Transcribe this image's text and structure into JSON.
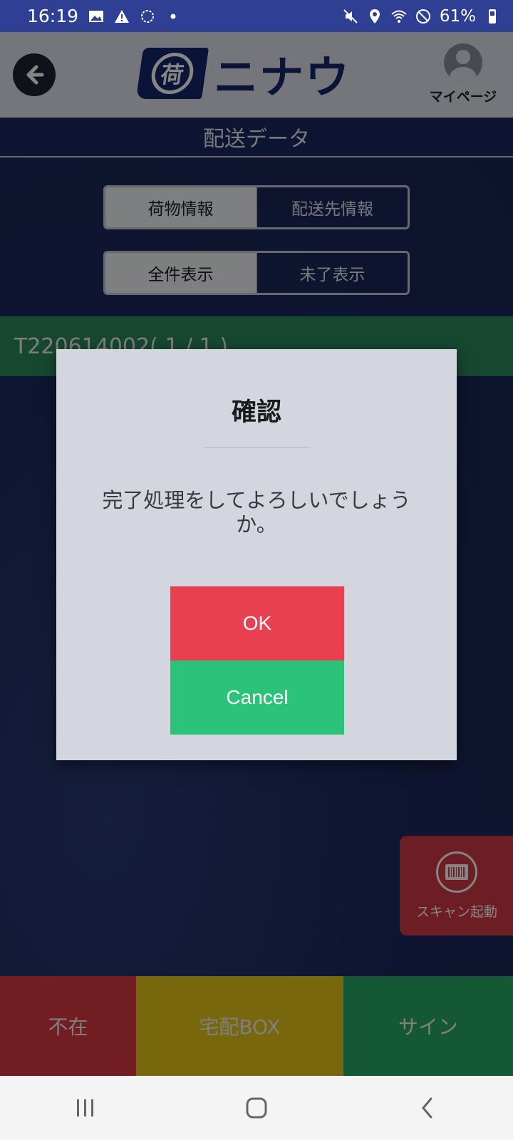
{
  "status_bar": {
    "time": "16:19",
    "battery": "61%",
    "left_icons": [
      "image-icon",
      "warning-icon",
      "sync-icon",
      "dot-icon"
    ],
    "right_icons": [
      "mute-icon",
      "location-icon",
      "wifi-icon",
      "no-disturb-icon",
      "battery-icon"
    ]
  },
  "header": {
    "logo_mark": "荷",
    "logo_text": "ニナウ",
    "mypage_label": "マイページ"
  },
  "page": {
    "title": "配送データ"
  },
  "tabs": {
    "info": [
      {
        "label": "荷物情報",
        "active": true
      },
      {
        "label": "配送先情報",
        "active": false
      }
    ],
    "filter": [
      {
        "label": "全件表示",
        "active": true
      },
      {
        "label": "未了表示",
        "active": false
      }
    ]
  },
  "tracking": {
    "label": "T220614002( 1 / 1 )"
  },
  "scan": {
    "label": "スキャン起動"
  },
  "actions": {
    "absent": "不在",
    "delivery_box": "宅配BOX",
    "sign": "サイン"
  },
  "dialog": {
    "title": "確認",
    "message": "完了処理をしてよろしいでしょうか。",
    "ok_label": "OK",
    "cancel_label": "Cancel"
  },
  "colors": {
    "status_bar": "#2e3f94",
    "brand": "#15276b",
    "ok": "#e84050",
    "cancel": "#2bc37a",
    "absent": "#d83842",
    "delivery_box": "#e8c51a",
    "sign": "#2aaa66"
  }
}
